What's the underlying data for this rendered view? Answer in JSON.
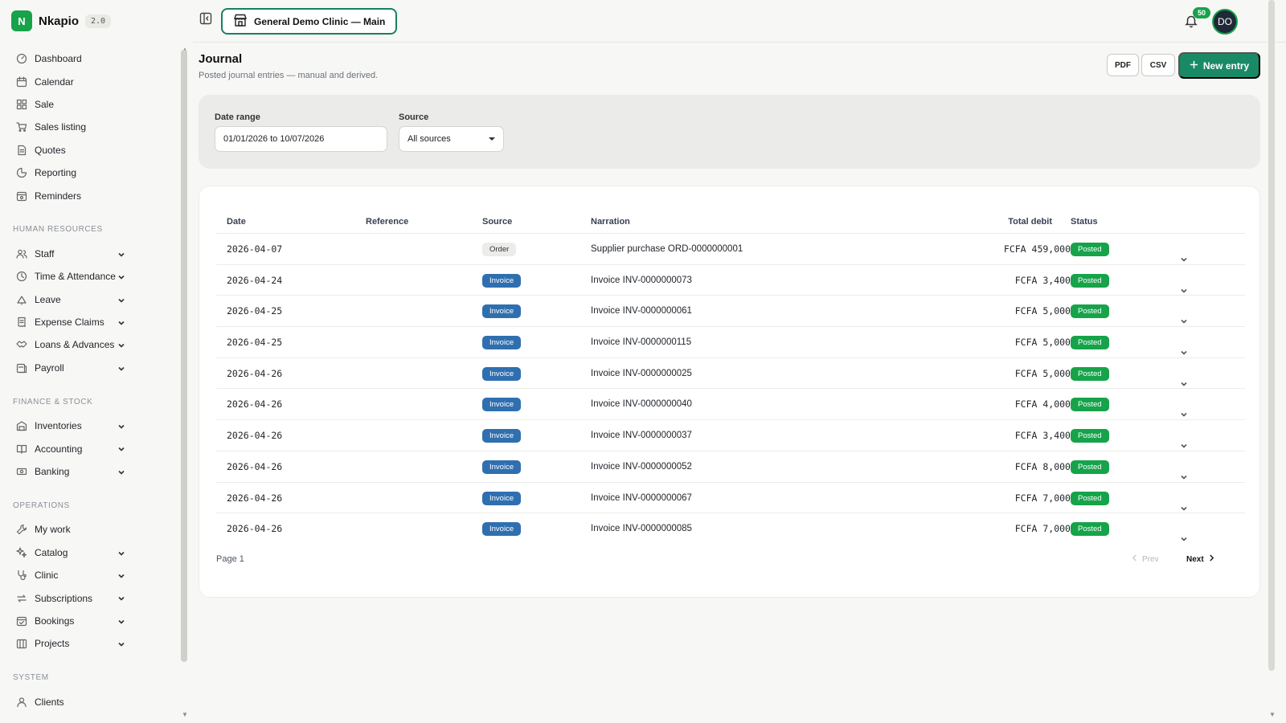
{
  "brand": {
    "logo_letter": "N",
    "name": "Nkapio",
    "version": "2.0"
  },
  "sidebar": {
    "top_items": [
      {
        "label": "Dashboard",
        "icon": "dashboard-icon"
      },
      {
        "label": "Calendar",
        "icon": "calendar-icon"
      },
      {
        "label": "Sale",
        "icon": "sale-icon"
      },
      {
        "label": "Sales listing",
        "icon": "cart-icon"
      },
      {
        "label": "Quotes",
        "icon": "document-icon"
      },
      {
        "label": "Reporting",
        "icon": "pie-chart-icon"
      },
      {
        "label": "Reminders",
        "icon": "bell-calendar-icon"
      }
    ],
    "sections": [
      {
        "title": "HUMAN RESOURCES",
        "items": [
          {
            "label": "Staff",
            "icon": "users-icon"
          },
          {
            "label": "Time & Attendance",
            "icon": "clock-icon"
          },
          {
            "label": "Leave",
            "icon": "leave-icon"
          },
          {
            "label": "Expense Claims",
            "icon": "receipt-icon"
          },
          {
            "label": "Loans & Advances",
            "icon": "handshake-icon"
          },
          {
            "label": "Payroll",
            "icon": "payroll-icon"
          }
        ]
      },
      {
        "title": "FINANCE & STOCK",
        "items": [
          {
            "label": "Inventories",
            "icon": "warehouse-icon"
          },
          {
            "label": "Accounting",
            "icon": "book-icon"
          },
          {
            "label": "Banking",
            "icon": "bank-icon"
          }
        ]
      },
      {
        "title": "OPERATIONS",
        "items": [
          {
            "label": "My work",
            "icon": "wrench-icon"
          },
          {
            "label": "Catalog",
            "icon": "sparkle-icon"
          },
          {
            "label": "Clinic",
            "icon": "stethoscope-icon"
          },
          {
            "label": "Subscriptions",
            "icon": "repeat-icon"
          },
          {
            "label": "Bookings",
            "icon": "calendar-check-icon"
          },
          {
            "label": "Projects",
            "icon": "projects-icon"
          }
        ]
      },
      {
        "title": "SYSTEM",
        "items": [
          {
            "label": "Clients",
            "icon": "user-icon"
          }
        ]
      }
    ]
  },
  "topbar": {
    "clinic_name": "General Demo Clinic — Main",
    "notifications_count": "50",
    "avatar_initials": "DO"
  },
  "header": {
    "title": "Journal",
    "subtitle": "Posted journal entries — manual and derived.",
    "pdf_label": "PDF",
    "csv_label": "CSV",
    "new_entry_label": "New entry"
  },
  "filters": {
    "date_range_label": "Date range",
    "date_range_value": "01/01/2026 to 10/07/2026",
    "source_label": "Source",
    "source_value": "All sources"
  },
  "table": {
    "headers": {
      "date": "Date",
      "reference": "Reference",
      "source": "Source",
      "narration": "Narration",
      "total_debit": "Total debit",
      "status": "Status"
    },
    "rows": [
      {
        "date": "2026-04-07",
        "reference": "",
        "source": "Order",
        "narration": "Supplier purchase ORD-0000000001",
        "total_debit": "FCFA 459,000",
        "status": "Posted"
      },
      {
        "date": "2026-04-24",
        "reference": "",
        "source": "Invoice",
        "narration": "Invoice INV-0000000073",
        "total_debit": "FCFA 3,400",
        "status": "Posted"
      },
      {
        "date": "2026-04-25",
        "reference": "",
        "source": "Invoice",
        "narration": "Invoice INV-0000000061",
        "total_debit": "FCFA 5,000",
        "status": "Posted"
      },
      {
        "date": "2026-04-25",
        "reference": "",
        "source": "Invoice",
        "narration": "Invoice INV-0000000115",
        "total_debit": "FCFA 5,000",
        "status": "Posted"
      },
      {
        "date": "2026-04-26",
        "reference": "",
        "source": "Invoice",
        "narration": "Invoice INV-0000000025",
        "total_debit": "FCFA 5,000",
        "status": "Posted"
      },
      {
        "date": "2026-04-26",
        "reference": "",
        "source": "Invoice",
        "narration": "Invoice INV-0000000040",
        "total_debit": "FCFA 4,000",
        "status": "Posted"
      },
      {
        "date": "2026-04-26",
        "reference": "",
        "source": "Invoice",
        "narration": "Invoice INV-0000000037",
        "total_debit": "FCFA 3,400",
        "status": "Posted"
      },
      {
        "date": "2026-04-26",
        "reference": "",
        "source": "Invoice",
        "narration": "Invoice INV-0000000052",
        "total_debit": "FCFA 8,000",
        "status": "Posted"
      },
      {
        "date": "2026-04-26",
        "reference": "",
        "source": "Invoice",
        "narration": "Invoice INV-0000000067",
        "total_debit": "FCFA 7,000",
        "status": "Posted"
      },
      {
        "date": "2026-04-26",
        "reference": "",
        "source": "Invoice",
        "narration": "Invoice INV-0000000085",
        "total_debit": "FCFA 7,000",
        "status": "Posted"
      }
    ]
  },
  "pagination": {
    "page_label": "Page 1",
    "prev_label": "Prev",
    "next_label": "Next"
  },
  "colors": {
    "brand": "#16a34a",
    "primary_button": "#1a8a66",
    "invoice_tag": "#2f6fb0",
    "posted_tag": "#16a34a"
  }
}
